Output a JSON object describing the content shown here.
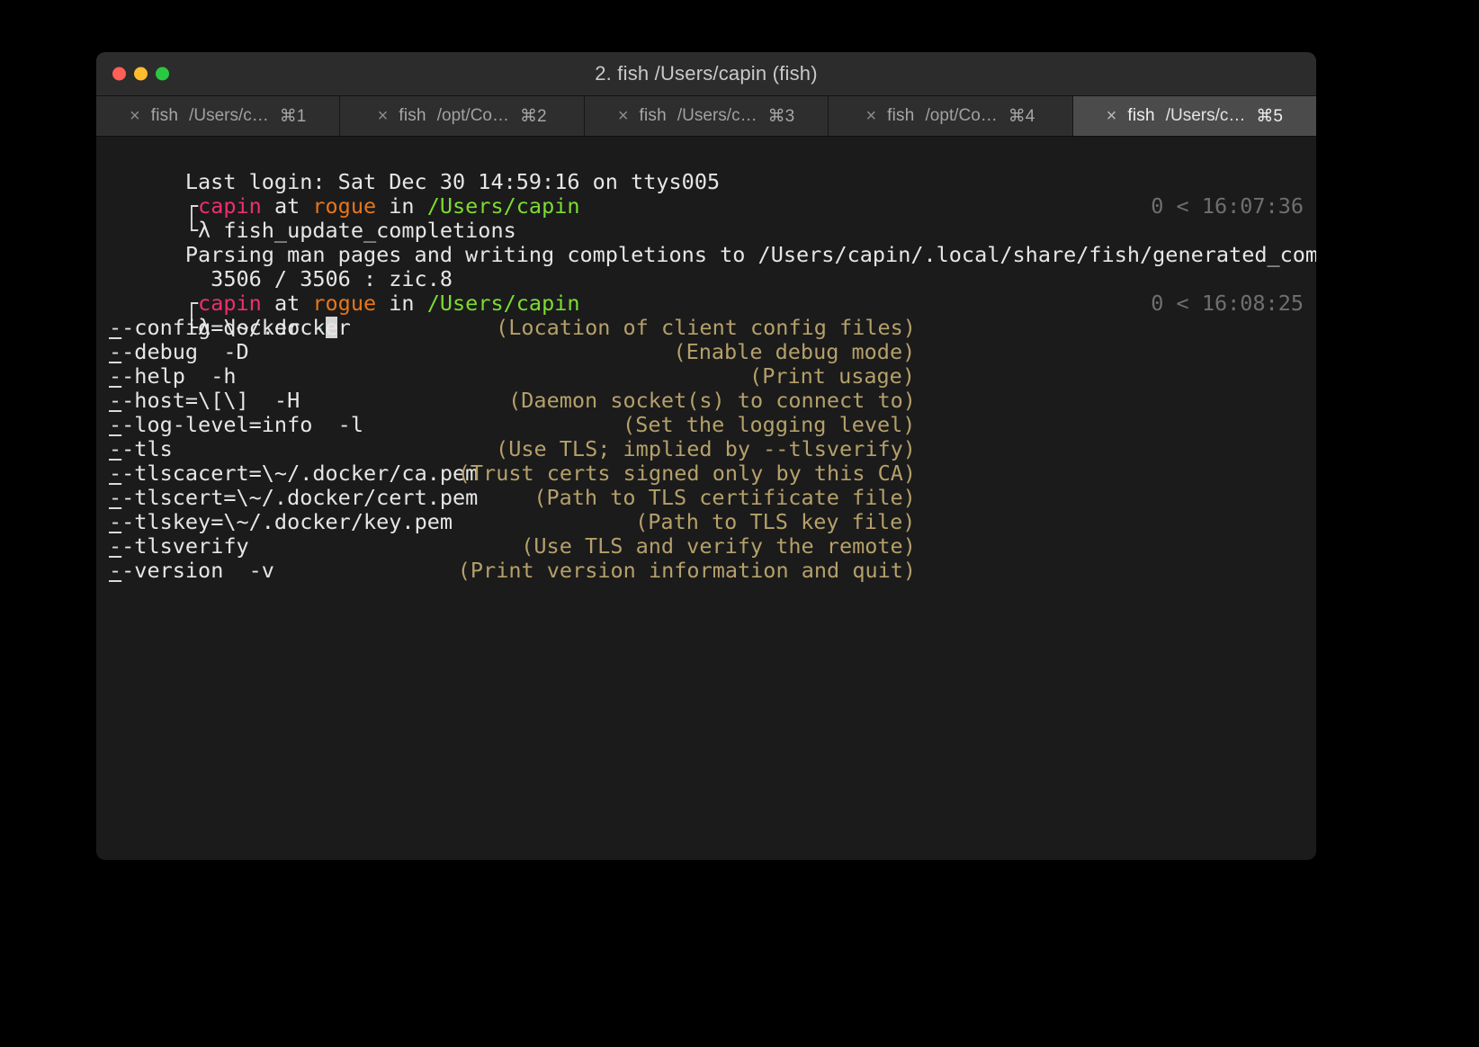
{
  "window": {
    "title": "2. fish  /Users/capin (fish)",
    "controls": [
      {
        "name": "close",
        "color": "#ff5f57"
      },
      {
        "name": "minimize",
        "color": "#febc2e"
      },
      {
        "name": "maximize",
        "color": "#28c840"
      }
    ]
  },
  "tabs": [
    {
      "close": "×",
      "shell": "fish",
      "path": "/Users/c…",
      "key": "⌘1",
      "active": false
    },
    {
      "close": "×",
      "shell": "fish",
      "path": "/opt/Co…",
      "key": "⌘2",
      "active": false
    },
    {
      "close": "×",
      "shell": "fish",
      "path": "/Users/c…",
      "key": "⌘3",
      "active": false
    },
    {
      "close": "×",
      "shell": "fish",
      "path": "/opt/Co…",
      "key": "⌘4",
      "active": false
    },
    {
      "close": "×",
      "shell": "fish",
      "path": "/Users/c…",
      "key": "⌘5",
      "active": true
    }
  ],
  "terminal": {
    "login_line": "Last login: Sat Dec 30 14:59:16 on ttys005",
    "prompts": [
      {
        "user": "capin",
        "at": " at ",
        "host": "rogue",
        "in": " in ",
        "cwd": "/Users/capin",
        "lambda": "λ ",
        "command": "fish_update_completions",
        "status": "0",
        "arrow": "<",
        "time": "16:07:36"
      },
      {
        "user": "capin",
        "at": " at ",
        "host": "rogue",
        "in": " in ",
        "cwd": "/Users/capin",
        "lambda": "λ ",
        "command": "docker ",
        "typed_flag": "-",
        "status": "0",
        "arrow": "<",
        "time": "16:08:25"
      }
    ],
    "output_lines": [
      "Parsing man pages and writing completions to /Users/capin/.local/share/fish/generated_completions/",
      "  3506 / 3506 : zic.8"
    ],
    "completions": [
      {
        "prefix": "-",
        "name": "-config=\\~/.docker",
        "desc": "(Location of client config files)"
      },
      {
        "prefix": "-",
        "name": "-debug  -D",
        "desc": "(Enable debug mode)"
      },
      {
        "prefix": "-",
        "name": "-help  -h",
        "desc": "(Print usage)"
      },
      {
        "prefix": "-",
        "name": "-host=\\[\\]  -H",
        "desc": "(Daemon socket(s) to connect to)"
      },
      {
        "prefix": "-",
        "name": "-log-level=info  -l",
        "desc": "(Set the logging level)"
      },
      {
        "prefix": "-",
        "name": "-tls",
        "desc": "(Use TLS; implied by --tlsverify)"
      },
      {
        "prefix": "-",
        "name": "-tlscacert=\\~/.docker/ca.pem",
        "desc": "(Trust certs signed only by this CA)"
      },
      {
        "prefix": "-",
        "name": "-tlscert=\\~/.docker/cert.pem",
        "desc": "(Path to TLS certificate file)"
      },
      {
        "prefix": "-",
        "name": "-tlskey=\\~/.docker/key.pem",
        "desc": "(Path to TLS key file)"
      },
      {
        "prefix": "-",
        "name": "-tlsverify",
        "desc": "(Use TLS and verify the remote)"
      },
      {
        "prefix": "-",
        "name": "-version  -v",
        "desc": "(Print version information and quit)"
      }
    ]
  },
  "colors": {
    "bg": "#1b1b1b",
    "titlebar": "#2c2c2c",
    "tab_inactive": "#2e2e2e",
    "tab_active": "#4b4b4b",
    "user": "#ef2f6e",
    "host": "#e8761a",
    "path": "#7ddc30",
    "description": "#b5a06a",
    "dim": "#6f6f6f"
  }
}
